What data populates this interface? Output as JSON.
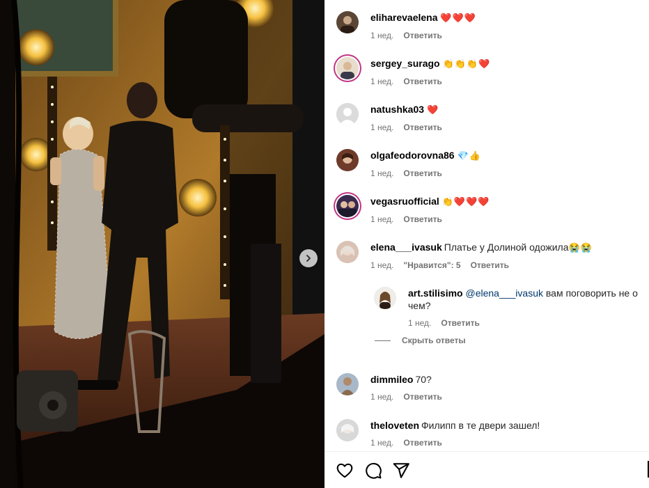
{
  "media": {
    "next_icon": "chevron-right-icon"
  },
  "comments": [
    {
      "username": "eliharevaelena",
      "text": "",
      "emoji": "❤️❤️❤️",
      "time": "1 нед.",
      "likes_label": "",
      "reply_label": "Ответить",
      "avatar_ring": false,
      "avatar_color": "#5b4636"
    },
    {
      "username": "sergey_surago",
      "text": "",
      "emoji": "👏👏👏❤️",
      "time": "1 нед.",
      "likes_label": "",
      "reply_label": "Ответить",
      "avatar_ring": true,
      "avatar_color": "#c9b08a"
    },
    {
      "username": "natushka03",
      "text": "",
      "emoji": "❤️",
      "time": "1 нед.",
      "likes_label": "",
      "reply_label": "Ответить",
      "avatar_ring": false,
      "avatar_color": "#dbdbdb"
    },
    {
      "username": "olgafeodorovna86",
      "text": "",
      "emoji": "💎👍",
      "time": "1 нед.",
      "likes_label": "",
      "reply_label": "Ответить",
      "avatar_ring": false,
      "avatar_color": "#6e3a2a"
    },
    {
      "username": "vegasruofficial",
      "text": "",
      "emoji": "👏❤️❤️❤️",
      "time": "1 нед.",
      "likes_label": "",
      "reply_label": "Ответить",
      "avatar_ring": true,
      "avatar_color": "#3a2a4e"
    },
    {
      "username": "elena___ivasuk",
      "text": "Платье у Долиной одожила",
      "emoji": "😭😭",
      "time": "1 нед.",
      "likes_label": "\"Нравится\": 5",
      "reply_label": "Ответить",
      "avatar_ring": false,
      "avatar_color": "#d9c2b4"
    }
  ],
  "reply": {
    "username": "art.stilisimo",
    "mention": "@elena___ivasuk",
    "text_line1": "вам поговорить не о",
    "text_line2": "чем?",
    "time": "1 нед.",
    "reply_label": "Ответить",
    "avatar_color": "#8a6a4a"
  },
  "hide_replies_label": "Скрыть ответы",
  "comments_after": [
    {
      "username": "dimmileo",
      "text": "70?",
      "emoji": "",
      "time": "1 нед.",
      "likes_label": "",
      "reply_label": "Ответить",
      "avatar_ring": false,
      "avatar_color": "#a08a74"
    },
    {
      "username": "theloveten",
      "text": "Филипп в те двери зашел!",
      "emoji": "",
      "time": "1 нед.",
      "likes_label": "",
      "reply_label": "Ответить",
      "avatar_ring": false,
      "avatar_color": "#c8c8c8"
    }
  ],
  "actions": {
    "like_icon": "heart-icon",
    "comment_icon": "comment-icon",
    "share_icon": "send-icon"
  },
  "colors": {
    "text_primary": "#000000",
    "text_secondary": "#737373",
    "mention": "#00376b",
    "story_ring": "#c13584"
  }
}
